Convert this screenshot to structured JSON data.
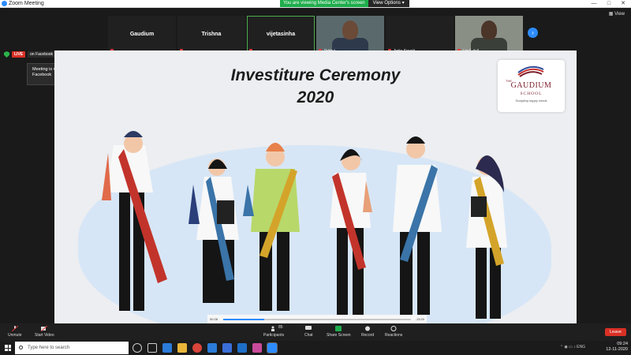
{
  "window": {
    "title": "Zoom Meeting",
    "controls": [
      "—",
      "□",
      "✕"
    ]
  },
  "view_banner": {
    "message": "You are viewing Media Center's screen",
    "options": "View Options ▾"
  },
  "view_button": "View",
  "participants": [
    {
      "name": "Gaudium",
      "label": "",
      "video": false
    },
    {
      "name": "Trishna",
      "label": "",
      "video": false
    },
    {
      "name": "vijetasinha",
      "label": "",
      "video": false
    },
    {
      "name": "",
      "label": "Prithvi",
      "video": true
    },
    {
      "name": "",
      "label": "Anita Sreejit",
      "video": false
    },
    {
      "name": "",
      "label": "Usr3-dell",
      "video": true
    }
  ],
  "live": {
    "badge": "LIVE",
    "platform": "on Facebook",
    "tooltip": "Meeting is now streaming live on Facebook"
  },
  "slide": {
    "title_line1": "Investiture Ceremony",
    "title_line2": "2020",
    "logo": {
      "the": "THE",
      "name": "GAUDIUM",
      "school": "SCHOOL",
      "tagline": "Sculpting happy minds"
    }
  },
  "playback": {
    "elapsed": "00:28",
    "remaining": "-13:20",
    "progress": 0.22
  },
  "toolbar": {
    "unmute": "Unmute",
    "start_video": "Start Video",
    "participants": "Participants",
    "participants_count": "85",
    "chat": "Chat",
    "share_screen": "Share Screen",
    "record": "Record",
    "reactions": "Reactions",
    "leave": "Leave"
  },
  "taskbar": {
    "search_placeholder": "Type here to search",
    "language": "ENG",
    "time": "09:24",
    "date": "12-11-2020"
  },
  "colors": {
    "zoom_blue": "#2d8cff",
    "live_red": "#d93025",
    "share_green": "#1fad4c"
  }
}
